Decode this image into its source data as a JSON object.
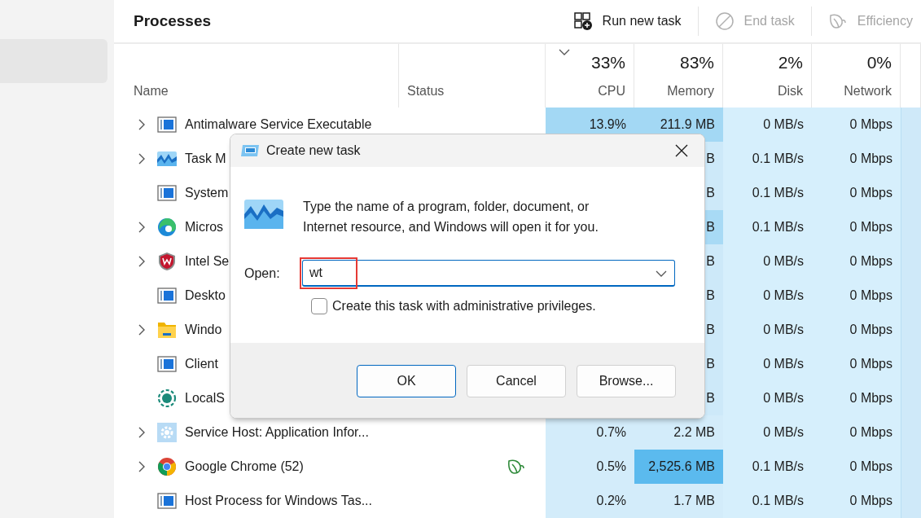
{
  "sidebar": {
    "items": [
      {
        "selected": true
      }
    ]
  },
  "header": {
    "title": "Processes",
    "actions": [
      {
        "label": "Run new task",
        "kind": "run",
        "disabled": false
      },
      {
        "label": "End task",
        "kind": "end",
        "disabled": true
      },
      {
        "label": "Efficiency",
        "kind": "efficiency",
        "disabled": true
      }
    ]
  },
  "table": {
    "columns": [
      {
        "label": "Name"
      },
      {
        "label": "Status"
      },
      {
        "label": "CPU",
        "total": "33%",
        "sorted": true
      },
      {
        "label": "Memory",
        "total": "83%",
        "sorted": false
      },
      {
        "label": "Disk",
        "total": "2%",
        "sorted": false
      },
      {
        "label": "Network",
        "total": "0%",
        "sorted": false
      }
    ],
    "rows": [
      {
        "kind": "window",
        "expandable": true,
        "efficiency": false,
        "cells": [
          {
            "text": "Antimalware Service Executable"
          },
          null,
          {
            "text": "13.9%",
            "color": "#a3d8f4"
          },
          {
            "text": "211.9 MB",
            "color": "#a3d8f4"
          },
          {
            "text": "0 MB/s",
            "color": "#d6effc"
          },
          {
            "text": "0 Mbps",
            "color": "#d6effc"
          }
        ]
      },
      {
        "kind": "monitor",
        "expandable": true,
        "efficiency": false,
        "cells": [
          {
            "text": "Task M"
          },
          null,
          null,
          {
            "text": "B",
            "color": "#cde9f9"
          },
          {
            "text": "0.1 MB/s",
            "color": "#d6effc"
          },
          {
            "text": "0 Mbps",
            "color": "#d6effc"
          }
        ]
      },
      {
        "kind": "window",
        "expandable": false,
        "efficiency": false,
        "cells": [
          {
            "text": "System"
          },
          null,
          null,
          {
            "text": "B",
            "color": "#cde9f9"
          },
          {
            "text": "0.1 MB/s",
            "color": "#d6effc"
          },
          {
            "text": "0 Mbps",
            "color": "#d6effc"
          }
        ]
      },
      {
        "kind": "swirl",
        "expandable": true,
        "efficiency": false,
        "cells": [
          {
            "text": "Micros"
          },
          null,
          null,
          {
            "text": "B",
            "color": "#a8daf5"
          },
          {
            "text": "0.1 MB/s",
            "color": "#d6effc"
          },
          {
            "text": "0 Mbps",
            "color": "#d6effc"
          }
        ]
      },
      {
        "kind": "shield",
        "expandable": true,
        "efficiency": false,
        "cells": [
          {
            "text": "Intel Se"
          },
          null,
          null,
          {
            "text": "B",
            "color": "#cde9f9"
          },
          {
            "text": "0 MB/s",
            "color": "#d6effc"
          },
          {
            "text": "0 Mbps",
            "color": "#d6effc"
          }
        ]
      },
      {
        "kind": "window",
        "expandable": false,
        "efficiency": false,
        "cells": [
          {
            "text": "Deskto"
          },
          null,
          null,
          {
            "text": "B",
            "color": "#cde9f9"
          },
          {
            "text": "0 MB/s",
            "color": "#d6effc"
          },
          {
            "text": "0 Mbps",
            "color": "#d6effc"
          }
        ]
      },
      {
        "kind": "folder",
        "expandable": true,
        "efficiency": false,
        "cells": [
          {
            "text": "Windo"
          },
          null,
          null,
          {
            "text": "B",
            "color": "#cde9f9"
          },
          {
            "text": "0 MB/s",
            "color": "#d6effc"
          },
          {
            "text": "0 Mbps",
            "color": "#d6effc"
          }
        ]
      },
      {
        "kind": "window",
        "expandable": false,
        "efficiency": false,
        "cells": [
          {
            "text": "Client"
          },
          null,
          null,
          {
            "text": "B",
            "color": "#cde9f9"
          },
          {
            "text": "0 MB/s",
            "color": "#d6effc"
          },
          {
            "text": "0 Mbps",
            "color": "#d6effc"
          }
        ]
      },
      {
        "kind": "ring",
        "expandable": false,
        "efficiency": false,
        "cells": [
          {
            "text": "LocalS"
          },
          null,
          null,
          {
            "text": "B",
            "color": "#cde9f9"
          },
          {
            "text": "0 MB/s",
            "color": "#d6effc"
          },
          {
            "text": "0 Mbps",
            "color": "#d6effc"
          }
        ]
      },
      {
        "kind": "gear",
        "expandable": true,
        "efficiency": false,
        "cells": [
          {
            "text": "Service Host: Application Infor..."
          },
          null,
          {
            "text": "0.7%",
            "color": "#d3ecfa"
          },
          {
            "text": "2.2 MB",
            "color": "#d3ecfa"
          },
          {
            "text": "0 MB/s",
            "color": "#d6effc"
          },
          {
            "text": "0 Mbps",
            "color": "#d6effc"
          }
        ]
      },
      {
        "kind": "chrome",
        "expandable": true,
        "efficiency": true,
        "cells": [
          {
            "text": "Google Chrome (52)"
          },
          null,
          {
            "text": "0.5%",
            "color": "#d3ecfa"
          },
          {
            "text": "2,525.6 MB",
            "color": "#5bbaee"
          },
          {
            "text": "0.1 MB/s",
            "color": "#d6effc"
          },
          {
            "text": "0 Mbps",
            "color": "#d6effc"
          }
        ]
      },
      {
        "kind": "window",
        "expandable": false,
        "efficiency": false,
        "cells": [
          {
            "text": "Host Process for Windows Tas..."
          },
          null,
          {
            "text": "0.2%",
            "color": "#d3ecfa"
          },
          {
            "text": "1.7 MB",
            "color": "#d3ecfa"
          },
          {
            "text": "0.1 MB/s",
            "color": "#d6effc"
          },
          {
            "text": "0 Mbps",
            "color": "#d6effc"
          }
        ]
      }
    ]
  },
  "dialog": {
    "title": "Create new task",
    "message": "Type the name of a program, folder, document, or Internet resource, and Windows will open it for you.",
    "open_label": "Open:",
    "open_value": "wt",
    "highlighted": true,
    "admin_label": "Create this task with administrative privileges.",
    "admin_checked": false,
    "buttons": [
      {
        "label": "OK",
        "default": true
      },
      {
        "label": "Cancel",
        "default": false
      },
      {
        "label": "Browse...",
        "default": false
      }
    ]
  }
}
